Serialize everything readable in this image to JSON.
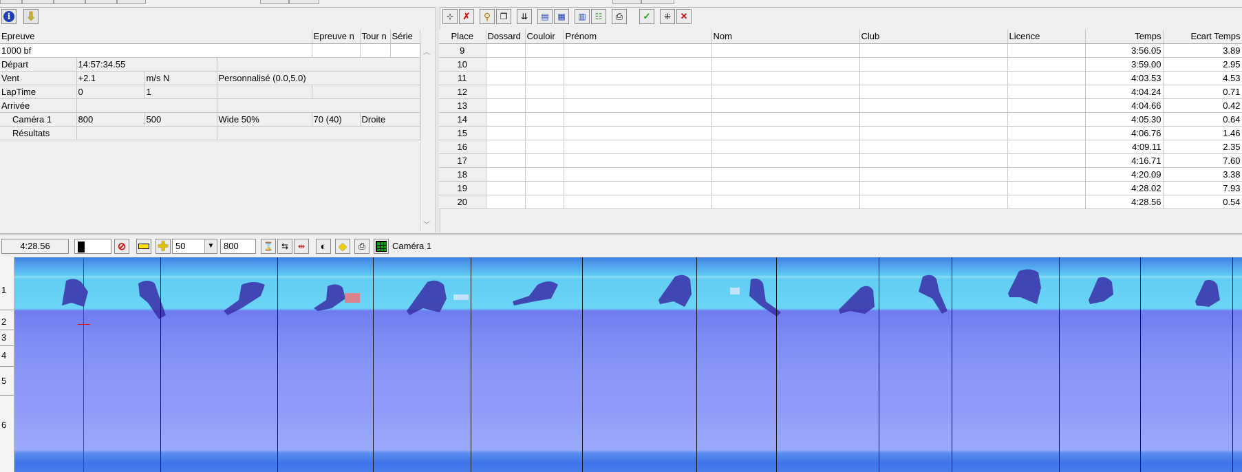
{
  "left_toolbar": {
    "info_icon": "info-icon",
    "download_icon": "arrow-down-icon"
  },
  "event_header": {
    "col1": "Epreuve",
    "col2": "Epreuve n",
    "col3": "Tour n",
    "col4": "Série"
  },
  "event": {
    "name": "1000 bf",
    "rows": [
      {
        "label": "Départ",
        "c1": "14:57:34.55",
        "c2": "",
        "c3": "",
        "c4": ""
      },
      {
        "label": "Vent",
        "c1": "+2.1",
        "c2": "m/s N",
        "c3": "Personnalisé (0.0,5.0)",
        "c4": ""
      },
      {
        "label": "LapTime",
        "c1": "0",
        "c2": "1",
        "c3": "",
        "c4": ""
      },
      {
        "label": "Arrivée",
        "c1": "",
        "c2": "",
        "c3": "",
        "c4": ""
      }
    ],
    "camera": {
      "label": "Caméra 1",
      "v1": "800",
      "v2": "500",
      "v3": "Wide 50%",
      "v4": "70  (40)",
      "v5": "Droite"
    },
    "results": {
      "label": "Résultats"
    }
  },
  "results_header": [
    "Place",
    "Dossard",
    "Couloir",
    "Prénom",
    "Nom",
    "Club",
    "Licence",
    "Temps",
    "Ecart Temps"
  ],
  "results_rows": [
    {
      "place": "9",
      "temps": "3:56.05",
      "ecart": "3.89"
    },
    {
      "place": "10",
      "temps": "3:59.00",
      "ecart": "2.95"
    },
    {
      "place": "11",
      "temps": "4:03.53",
      "ecart": "4.53"
    },
    {
      "place": "12",
      "temps": "4:04.24",
      "ecart": "0.71"
    },
    {
      "place": "13",
      "temps": "4:04.66",
      "ecart": "0.42"
    },
    {
      "place": "14",
      "temps": "4:05.30",
      "ecart": "0.64"
    },
    {
      "place": "15",
      "temps": "4:06.76",
      "ecart": "1.46"
    },
    {
      "place": "16",
      "temps": "4:09.11",
      "ecart": "2.35"
    },
    {
      "place": "17",
      "temps": "4:16.71",
      "ecart": "7.60"
    },
    {
      "place": "18",
      "temps": "4:20.09",
      "ecart": "3.38"
    },
    {
      "place": "19",
      "temps": "4:28.02",
      "ecart": "7.93"
    },
    {
      "place": "20",
      "temps": "4:28.56",
      "ecart": "0.54"
    }
  ],
  "image_toolbar": {
    "time": "4:28.56",
    "zoom_value": "50",
    "width_value": "800",
    "camera_label": "Caméra 1"
  },
  "lanes": [
    "1",
    "2",
    "3",
    "4",
    "5",
    "6"
  ],
  "colors": {
    "finish_top": "#61cdf2",
    "finish_bottom": "#8a97f6",
    "cursor_line": "#e01010"
  }
}
